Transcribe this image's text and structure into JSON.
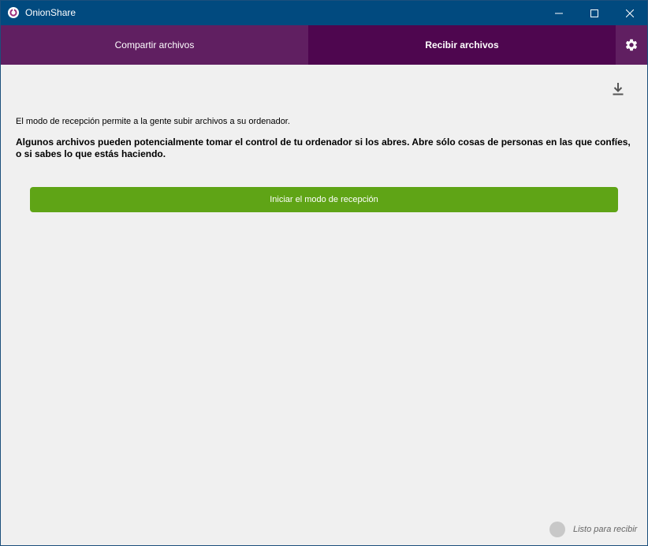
{
  "window": {
    "title": "OnionShare",
    "title_icon": "onionshare-logo-icon",
    "controls": [
      "minimize-icon",
      "maximize-icon",
      "close-icon"
    ]
  },
  "tabs": {
    "share_label": "Compartir archivos",
    "receive_label": "Recibir archivos",
    "active": "receive",
    "settings_icon": "gear-icon"
  },
  "main": {
    "download_icon": "download-icon",
    "description": "El modo de recepción permite a la gente subir archivos a su ordenador.",
    "warning": "Algunos archivos pueden potencialmente tomar el control de tu ordenador si los abres. Abre sólo cosas de personas en las que confíes, o si sabes lo que estás haciendo.",
    "start_button_label": "Iniciar el modo de recepción"
  },
  "status": {
    "text": "Listo para recibir",
    "indicator_icon": "status-dot-icon"
  },
  "colors": {
    "titlebar": "#014a7f",
    "tab_inactive": "#601f61",
    "tab_active": "#4e064f",
    "button_green": "#5fa416",
    "background": "#f0f0f0"
  }
}
